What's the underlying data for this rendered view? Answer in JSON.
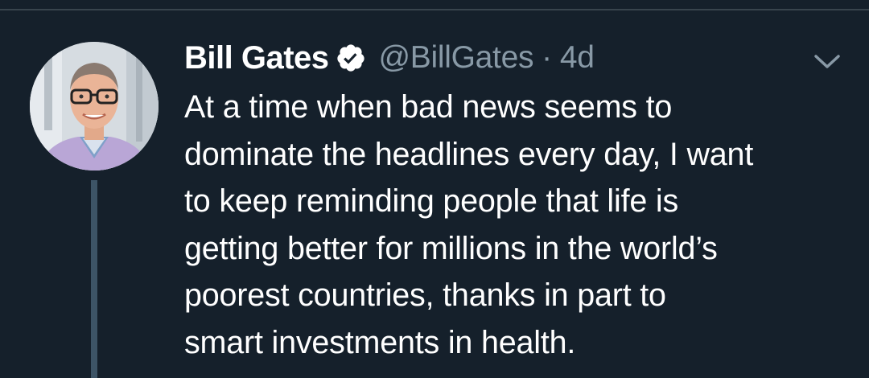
{
  "colors": {
    "background": "#15202b",
    "divider": "#38444d",
    "thread_line": "#3d5466",
    "text_primary": "#ffffff",
    "text_secondary": "#8899a6"
  },
  "author": {
    "display_name": "Bill Gates",
    "handle": "@BillGates",
    "separator": "·",
    "timestamp": "4d",
    "verified": true,
    "avatar_icon": "profile-photo"
  },
  "tweet": {
    "lines": [
      "At a time when bad news seems to",
      "dominate the headlines every day, I want",
      "to keep reminding people that life is",
      "getting better for millions in the world’s",
      "poorest countries, thanks in part to",
      "smart investments in health."
    ]
  },
  "icons": {
    "verified": "verified-badge-icon",
    "menu": "chevron-down-icon"
  }
}
